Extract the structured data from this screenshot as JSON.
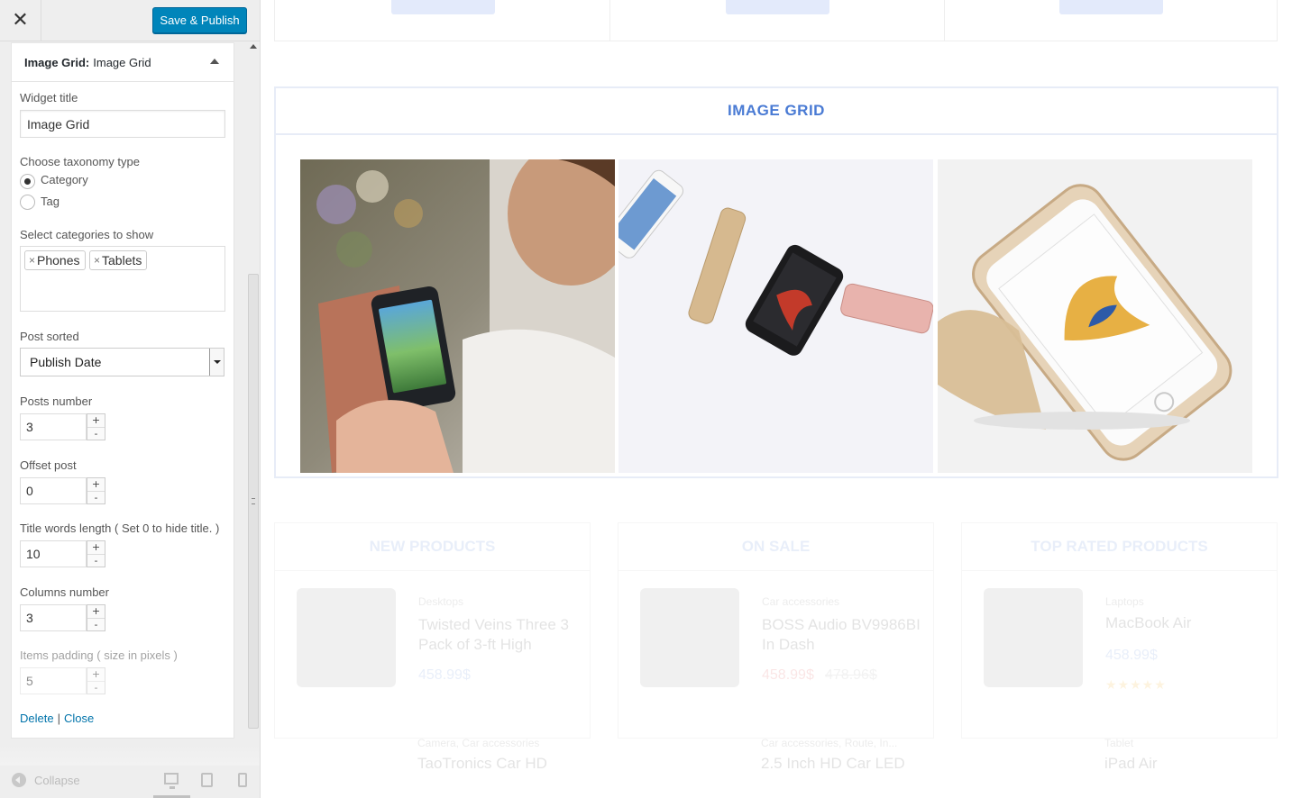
{
  "toolbar": {
    "close_label": "✕",
    "save_label": "Save & Publish"
  },
  "widget": {
    "title_bold": "Image Grid:",
    "title_name": "Image Grid",
    "widget_title_label": "Widget title",
    "widget_title_value": "Image Grid",
    "taxonomy_label": "Choose taxonomy type",
    "taxonomy_options": [
      "Category",
      "Tag"
    ],
    "taxonomy_selected": "Category",
    "categories_label": "Select categories to show",
    "categories": [
      "Phones",
      "Tablets"
    ],
    "sort_label": "Post sorted",
    "sort_value": "Publish Date",
    "posts_number_label": "Posts number",
    "posts_number": "3",
    "offset_label": "Offset post",
    "offset": "0",
    "title_words_label": "Title words length ( Set 0 to hide title. )",
    "title_words": "10",
    "columns_label": "Columns number",
    "columns": "3",
    "padding_label": "Items padding ( size in pixels )",
    "padding": "5",
    "delete_link": "Delete",
    "separator": "|",
    "close_link": "Close"
  },
  "footer": {
    "collapse_label": "Collapse"
  },
  "preview": {
    "grid_title": "IMAGE GRID",
    "product_columns": [
      {
        "title": "NEW PRODUCTS",
        "category": "Desktops",
        "name": "Twisted Veins Three 3 Pack of 3-ft High",
        "price": "458.99$",
        "row2_category": "Camera, Car accessories",
        "row2_name": "TaoTronics Car HD"
      },
      {
        "title": "ON SALE",
        "category": "Car accessories",
        "name": "BOSS Audio BV9986BI In Dash",
        "price": "458.99$",
        "old_price": "478.96$",
        "row2_category": "Car accessories, Route, In...",
        "row2_name": "2.5 Inch HD Car LED"
      },
      {
        "title": "TOP RATED PRODUCTS",
        "category": "Laptops",
        "name": "MacBook Air",
        "price": "458.99$",
        "stars": "★★★★★",
        "row2_category": "Tablet",
        "row2_name": "iPad Air"
      }
    ]
  },
  "colors": {
    "accent": "#0085ba",
    "link": "#0073aa",
    "grid_title": "#4a7bd4"
  }
}
